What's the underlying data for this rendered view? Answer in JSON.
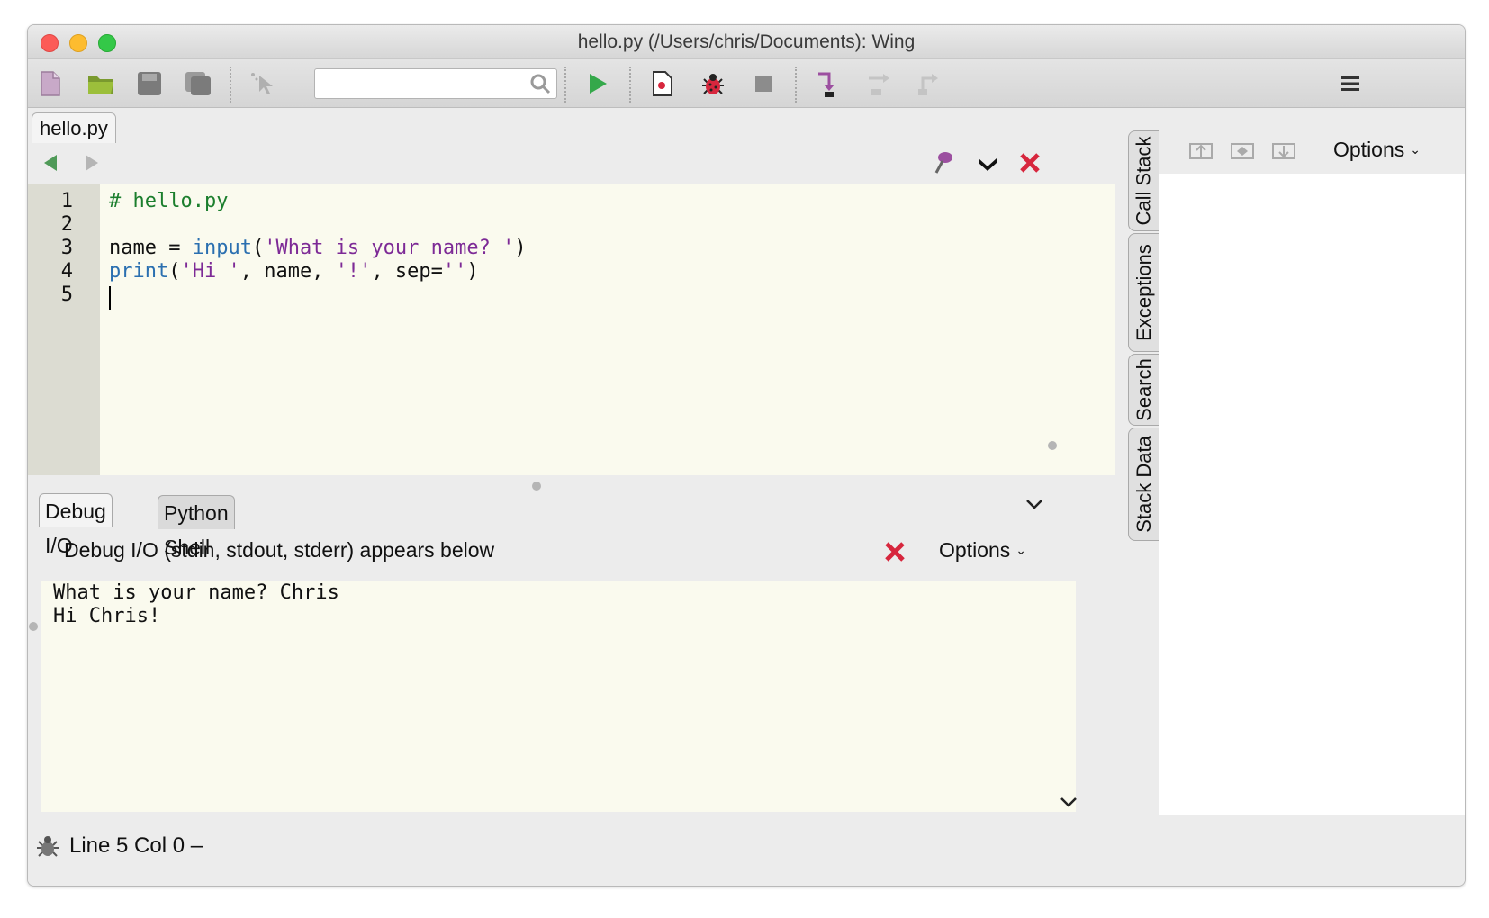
{
  "window": {
    "title": "hello.py (/Users/chris/Documents): Wing"
  },
  "toolbar": {
    "search_value": ""
  },
  "editor": {
    "tab": "hello.py",
    "line_numbers": [
      "1",
      "2",
      "3",
      "4",
      "5"
    ],
    "lines": {
      "l1_comment": "# hello.py",
      "l3_a": "name = ",
      "l3_builtin": "input",
      "l3_b": "(",
      "l3_str": "'What is your name? '",
      "l3_c": ")",
      "l4_builtin": "print",
      "l4_a": "(",
      "l4_str1": "'Hi '",
      "l4_b": ", name, ",
      "l4_str2": "'!'",
      "l4_c": ", sep=",
      "l4_str3": "''",
      "l4_d": ")"
    }
  },
  "bottom_panel": {
    "tabs": [
      "Debug I/O",
      "Python Shell"
    ],
    "header": "Debug I/O (stdin, stdout, stderr) appears below",
    "options_label": "Options",
    "output": [
      "What is your name? Chris",
      "Hi Chris!"
    ]
  },
  "side_tabs": [
    "Call Stack",
    "Exceptions",
    "Search",
    "Stack Data"
  ],
  "right_panel": {
    "options_label": "Options"
  },
  "status": {
    "text": "Line 5 Col 0 –"
  }
}
